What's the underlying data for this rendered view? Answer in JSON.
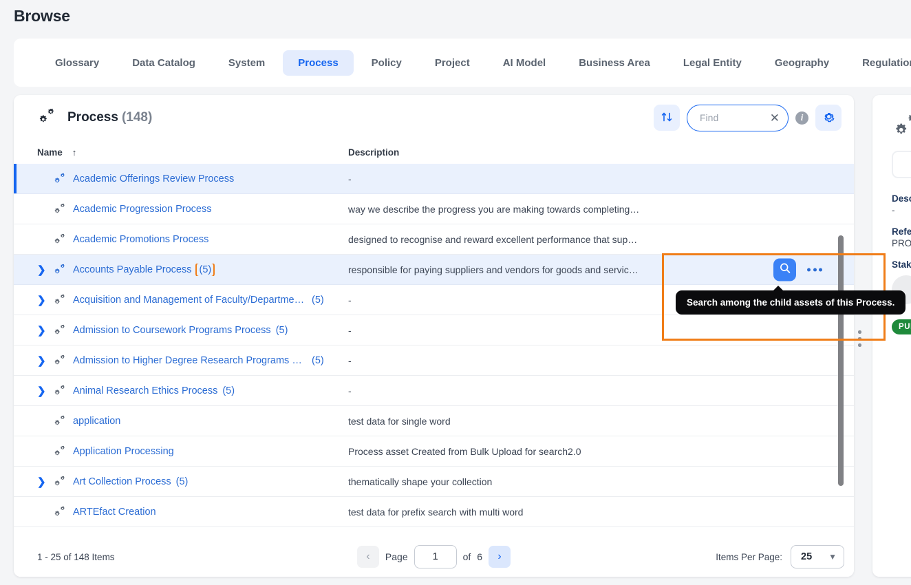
{
  "page": {
    "title": "Browse"
  },
  "tabs": [
    {
      "label": "Glossary",
      "active": false
    },
    {
      "label": "Data Catalog",
      "active": false
    },
    {
      "label": "System",
      "active": false
    },
    {
      "label": "Process",
      "active": true
    },
    {
      "label": "Policy",
      "active": false
    },
    {
      "label": "Project",
      "active": false
    },
    {
      "label": "AI Model",
      "active": false
    },
    {
      "label": "Business Area",
      "active": false
    },
    {
      "label": "Legal Entity",
      "active": false
    },
    {
      "label": "Geography",
      "active": false
    },
    {
      "label": "Regulation",
      "active": false
    }
  ],
  "list_panel": {
    "icon": "double-gear-icon",
    "title": "Process",
    "count": "(148)",
    "toolbar": {
      "sort_icon": "sort-arrows-icon",
      "find_placeholder": "Find",
      "find_value": "",
      "clear_icon": "close-icon",
      "info_icon": "info-icon",
      "settings_icon": "gear-icon"
    },
    "columns": {
      "name": "Name",
      "sort_indicator": "↑",
      "description": "Description"
    },
    "rows": [
      {
        "name": "Academic Offerings Review Process",
        "count": "",
        "desc": "-",
        "expandable": false,
        "selected": true,
        "highlight_count": false
      },
      {
        "name": "Academic Progression Process",
        "count": "",
        "desc": "way we describe the progress you are making towards completing…",
        "expandable": false,
        "selected": false,
        "highlight_count": false
      },
      {
        "name": "Academic Promotions Process",
        "count": "",
        "desc": "designed to recognise and reward excellent performance that sup…",
        "expandable": false,
        "selected": false,
        "highlight_count": false
      },
      {
        "name": "Accounts Payable Process",
        "count": "(5)",
        "desc": "responsible for paying suppliers and vendors for goods and servic…",
        "expandable": true,
        "selected": true,
        "highlight_count": true
      },
      {
        "name": "Acquisition and Management of Faculty/Department …",
        "count": "(5)",
        "desc": "-",
        "expandable": true,
        "selected": false,
        "highlight_count": false
      },
      {
        "name": "Admission to Coursework Programs Process",
        "count": "(5)",
        "desc": "-",
        "expandable": true,
        "selected": false,
        "highlight_count": false
      },
      {
        "name": "Admission to Higher Degree Research Programs Proc…",
        "count": "(5)",
        "desc": "-",
        "expandable": true,
        "selected": false,
        "highlight_count": false
      },
      {
        "name": "Animal Research Ethics Process",
        "count": "(5)",
        "desc": "-",
        "expandable": true,
        "selected": false,
        "highlight_count": false
      },
      {
        "name": "application",
        "count": "",
        "desc": "test data for single word",
        "expandable": false,
        "selected": false,
        "highlight_count": false
      },
      {
        "name": "Application Processing",
        "count": "",
        "desc": "Process asset Created from Bulk Upload for search2.0",
        "expandable": false,
        "selected": false,
        "highlight_count": false
      },
      {
        "name": "Art Collection Process",
        "count": "(5)",
        "desc": "thematically shape your collection",
        "expandable": true,
        "selected": false,
        "highlight_count": false
      },
      {
        "name": "ARTEfact Creation",
        "count": "",
        "desc": "test data for prefix search with multi word",
        "expandable": false,
        "selected": false,
        "highlight_count": false
      }
    ],
    "row_actions": {
      "search_icon": "search-icon",
      "more_icon": "more-horizontal-icon"
    },
    "tooltip": "Search among the child assets of this Process."
  },
  "pagination": {
    "summary": "1 - 25 of 148 Items",
    "prev_icon": "chevron-left-icon",
    "page_label": "Page",
    "page_value": "1",
    "of_label": "of",
    "total_pages": "6",
    "next_icon": "chevron-right-icon",
    "items_per_page_label": "Items Per Page:",
    "items_per_page_value": "25",
    "chevron_down_icon": "chevron-down-icon"
  },
  "detail_panel": {
    "icon": "double-gear-icon",
    "description_label": "Desc",
    "description_value": "-",
    "reference_label": "Refe",
    "reference_value": "PRO",
    "stakeholder_label": "Stak",
    "status_badge": "PUB"
  },
  "colors": {
    "accent_blue": "#1565f0",
    "link_blue": "#2b6cd4",
    "highlight_orange": "#f07d18",
    "selected_row": "#eaf1fd",
    "tooltip_bg": "#0b0b0d",
    "badge_green": "#1f8a3b",
    "page_bg": "#f4f5f7"
  }
}
